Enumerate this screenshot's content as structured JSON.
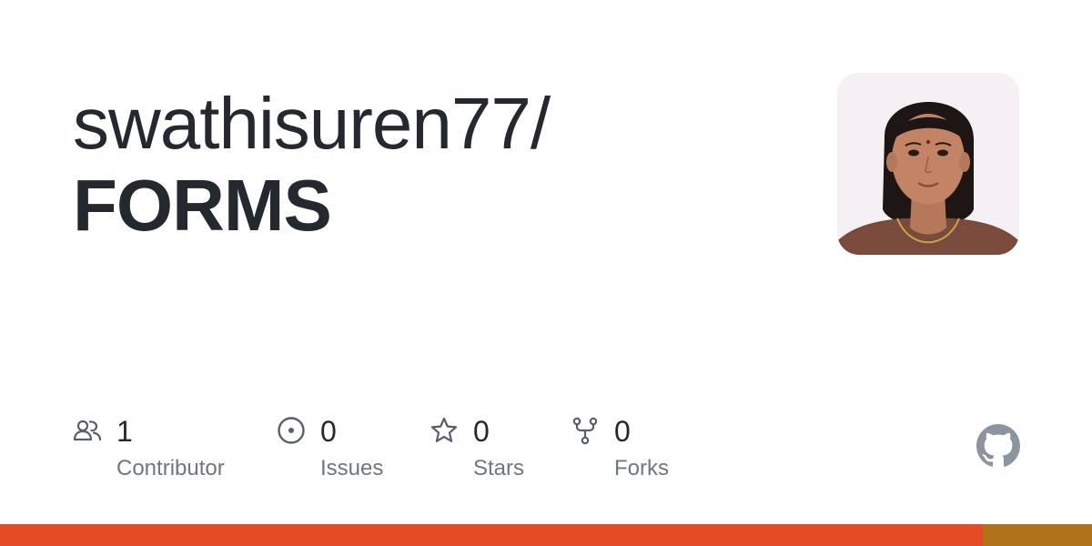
{
  "repo": {
    "owner": "swathisuren77/",
    "name": "FORMS"
  },
  "avatar": {
    "icon": "user-avatar"
  },
  "stats": {
    "contributors": {
      "count": "1",
      "label": "Contributor",
      "icon": "people-icon"
    },
    "issues": {
      "count": "0",
      "label": "Issues",
      "icon": "issue-opened-icon"
    },
    "stars": {
      "count": "0",
      "label": "Stars",
      "icon": "star-icon"
    },
    "forks": {
      "count": "0",
      "label": "Forks",
      "icon": "repo-forked-icon"
    }
  },
  "brand": {
    "icon": "github-mark-icon"
  },
  "languages": [
    {
      "color": "#e34c26",
      "share": 0.9
    },
    {
      "color": "#b07219",
      "share": 0.1
    }
  ],
  "colors": {
    "text": "#24292f",
    "muted": "#6e7781",
    "icon": "#57606a"
  }
}
